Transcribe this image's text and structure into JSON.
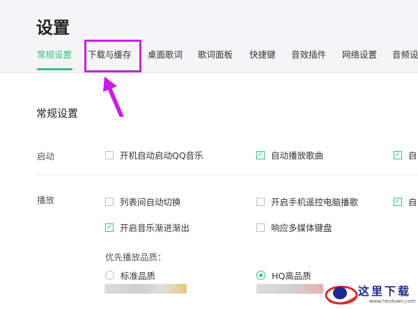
{
  "page_title": "设置",
  "tabs": [
    {
      "label": "常规设置",
      "active": true
    },
    {
      "label": "下载与缓存",
      "active": false
    },
    {
      "label": "桌面歌词",
      "active": false
    },
    {
      "label": "歌词面板",
      "active": false
    },
    {
      "label": "快捷键",
      "active": false
    },
    {
      "label": "音效插件",
      "active": false
    },
    {
      "label": "网络设置",
      "active": false
    },
    {
      "label": "音频设",
      "active": false
    }
  ],
  "section_title": "常规设置",
  "startup": {
    "label": "启动",
    "options": [
      {
        "label": "开机自动启动QQ音乐",
        "checked": false
      },
      {
        "label": "自动播放歌曲",
        "checked": true
      },
      {
        "label": "自",
        "checked": true
      }
    ]
  },
  "playback": {
    "label": "播放",
    "options": [
      {
        "label": "列表间自动切换",
        "checked": false
      },
      {
        "label": "开启手机遥控电脑播歌",
        "checked": false
      },
      {
        "label": "开启音乐渐进渐出",
        "checked": true
      },
      {
        "label": "响应多媒体键盘",
        "checked": false
      },
      {
        "label": "自",
        "checked": true
      }
    ],
    "quality_label": "优先播放品质：",
    "quality_options": [
      {
        "label": "标准品质",
        "selected": false
      },
      {
        "label": "HQ高品质",
        "selected": true
      }
    ]
  },
  "watermark": {
    "name": "这里下载",
    "url": "www.herdown.com"
  },
  "colors": {
    "accent": "#31c27c",
    "annotation": "#c81fe0",
    "header_bg": "#f5f5f7"
  }
}
